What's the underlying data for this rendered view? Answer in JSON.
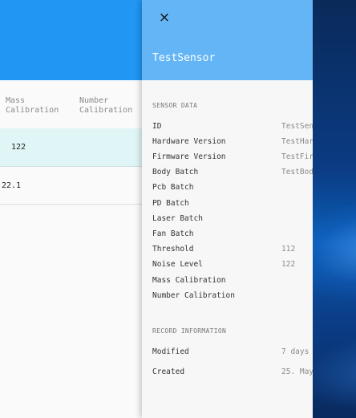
{
  "table": {
    "columns": [
      {
        "line1": "Mass",
        "line2": "Calibration"
      },
      {
        "line1": "Number",
        "line2": "Calibration"
      }
    ],
    "rows": [
      {
        "cell": "122"
      },
      {
        "cell": "22.1"
      }
    ]
  },
  "drawer": {
    "close_icon": "×",
    "title": "TestSensor",
    "sensor_section": "SENSOR DATA",
    "fields": [
      {
        "label": "ID",
        "value": "TestSen"
      },
      {
        "label": "Hardware Version",
        "value": "TestHar"
      },
      {
        "label": "Firmware Version",
        "value": "TestFir"
      },
      {
        "label": "Body Batch",
        "value": "TestBod"
      },
      {
        "label": "Pcb Batch",
        "value": ""
      },
      {
        "label": "PD Batch",
        "value": ""
      },
      {
        "label": "Laser Batch",
        "value": ""
      },
      {
        "label": "Fan Batch",
        "value": ""
      },
      {
        "label": "Threshold",
        "value": "112"
      },
      {
        "label": "Noise Level",
        "value": "122"
      },
      {
        "label": "Mass Calibration",
        "value": ""
      },
      {
        "label": "Number Calibration",
        "value": ""
      }
    ],
    "record_section": "RECORD INFORMATION",
    "record": [
      {
        "label": "Modified",
        "value": "7 days"
      },
      {
        "label": "Created",
        "value": "25. May"
      }
    ]
  },
  "colors": {
    "app_header": "#2196f3",
    "drawer_header": "#64b5f6",
    "selected_row": "#e0f5f6"
  }
}
